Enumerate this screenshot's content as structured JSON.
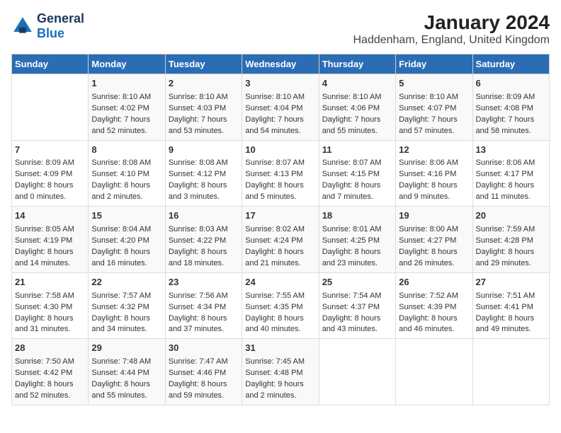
{
  "logo": {
    "general": "General",
    "blue": "Blue"
  },
  "title": "January 2024",
  "subtitle": "Haddenham, England, United Kingdom",
  "days_header": [
    "Sunday",
    "Monday",
    "Tuesday",
    "Wednesday",
    "Thursday",
    "Friday",
    "Saturday"
  ],
  "weeks": [
    [
      {
        "day": "",
        "data": ""
      },
      {
        "day": "1",
        "data": "Sunrise: 8:10 AM\nSunset: 4:02 PM\nDaylight: 7 hours\nand 52 minutes."
      },
      {
        "day": "2",
        "data": "Sunrise: 8:10 AM\nSunset: 4:03 PM\nDaylight: 7 hours\nand 53 minutes."
      },
      {
        "day": "3",
        "data": "Sunrise: 8:10 AM\nSunset: 4:04 PM\nDaylight: 7 hours\nand 54 minutes."
      },
      {
        "day": "4",
        "data": "Sunrise: 8:10 AM\nSunset: 4:06 PM\nDaylight: 7 hours\nand 55 minutes."
      },
      {
        "day": "5",
        "data": "Sunrise: 8:10 AM\nSunset: 4:07 PM\nDaylight: 7 hours\nand 57 minutes."
      },
      {
        "day": "6",
        "data": "Sunrise: 8:09 AM\nSunset: 4:08 PM\nDaylight: 7 hours\nand 58 minutes."
      }
    ],
    [
      {
        "day": "7",
        "data": "Sunrise: 8:09 AM\nSunset: 4:09 PM\nDaylight: 8 hours\nand 0 minutes."
      },
      {
        "day": "8",
        "data": "Sunrise: 8:08 AM\nSunset: 4:10 PM\nDaylight: 8 hours\nand 2 minutes."
      },
      {
        "day": "9",
        "data": "Sunrise: 8:08 AM\nSunset: 4:12 PM\nDaylight: 8 hours\nand 3 minutes."
      },
      {
        "day": "10",
        "data": "Sunrise: 8:07 AM\nSunset: 4:13 PM\nDaylight: 8 hours\nand 5 minutes."
      },
      {
        "day": "11",
        "data": "Sunrise: 8:07 AM\nSunset: 4:15 PM\nDaylight: 8 hours\nand 7 minutes."
      },
      {
        "day": "12",
        "data": "Sunrise: 8:06 AM\nSunset: 4:16 PM\nDaylight: 8 hours\nand 9 minutes."
      },
      {
        "day": "13",
        "data": "Sunrise: 8:06 AM\nSunset: 4:17 PM\nDaylight: 8 hours\nand 11 minutes."
      }
    ],
    [
      {
        "day": "14",
        "data": "Sunrise: 8:05 AM\nSunset: 4:19 PM\nDaylight: 8 hours\nand 14 minutes."
      },
      {
        "day": "15",
        "data": "Sunrise: 8:04 AM\nSunset: 4:20 PM\nDaylight: 8 hours\nand 16 minutes."
      },
      {
        "day": "16",
        "data": "Sunrise: 8:03 AM\nSunset: 4:22 PM\nDaylight: 8 hours\nand 18 minutes."
      },
      {
        "day": "17",
        "data": "Sunrise: 8:02 AM\nSunset: 4:24 PM\nDaylight: 8 hours\nand 21 minutes."
      },
      {
        "day": "18",
        "data": "Sunrise: 8:01 AM\nSunset: 4:25 PM\nDaylight: 8 hours\nand 23 minutes."
      },
      {
        "day": "19",
        "data": "Sunrise: 8:00 AM\nSunset: 4:27 PM\nDaylight: 8 hours\nand 26 minutes."
      },
      {
        "day": "20",
        "data": "Sunrise: 7:59 AM\nSunset: 4:28 PM\nDaylight: 8 hours\nand 29 minutes."
      }
    ],
    [
      {
        "day": "21",
        "data": "Sunrise: 7:58 AM\nSunset: 4:30 PM\nDaylight: 8 hours\nand 31 minutes."
      },
      {
        "day": "22",
        "data": "Sunrise: 7:57 AM\nSunset: 4:32 PM\nDaylight: 8 hours\nand 34 minutes."
      },
      {
        "day": "23",
        "data": "Sunrise: 7:56 AM\nSunset: 4:34 PM\nDaylight: 8 hours\nand 37 minutes."
      },
      {
        "day": "24",
        "data": "Sunrise: 7:55 AM\nSunset: 4:35 PM\nDaylight: 8 hours\nand 40 minutes."
      },
      {
        "day": "25",
        "data": "Sunrise: 7:54 AM\nSunset: 4:37 PM\nDaylight: 8 hours\nand 43 minutes."
      },
      {
        "day": "26",
        "data": "Sunrise: 7:52 AM\nSunset: 4:39 PM\nDaylight: 8 hours\nand 46 minutes."
      },
      {
        "day": "27",
        "data": "Sunrise: 7:51 AM\nSunset: 4:41 PM\nDaylight: 8 hours\nand 49 minutes."
      }
    ],
    [
      {
        "day": "28",
        "data": "Sunrise: 7:50 AM\nSunset: 4:42 PM\nDaylight: 8 hours\nand 52 minutes."
      },
      {
        "day": "29",
        "data": "Sunrise: 7:48 AM\nSunset: 4:44 PM\nDaylight: 8 hours\nand 55 minutes."
      },
      {
        "day": "30",
        "data": "Sunrise: 7:47 AM\nSunset: 4:46 PM\nDaylight: 8 hours\nand 59 minutes."
      },
      {
        "day": "31",
        "data": "Sunrise: 7:45 AM\nSunset: 4:48 PM\nDaylight: 9 hours\nand 2 minutes."
      },
      {
        "day": "",
        "data": ""
      },
      {
        "day": "",
        "data": ""
      },
      {
        "day": "",
        "data": ""
      }
    ]
  ]
}
